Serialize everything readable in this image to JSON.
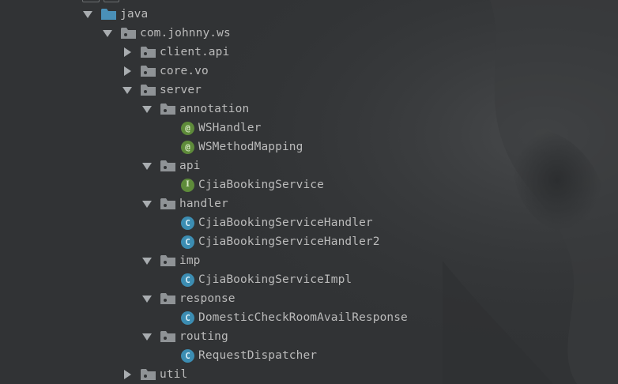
{
  "tree": {
    "src_java": {
      "label": "java",
      "expanded": true,
      "icon": "source-folder-icon"
    },
    "package_root": {
      "label": "com.johnny.ws",
      "expanded": true,
      "icon": "package-icon"
    },
    "client_api": {
      "label": "client.api",
      "expanded": false,
      "icon": "package-icon"
    },
    "core_vo": {
      "label": "core.vo",
      "expanded": false,
      "icon": "package-icon"
    },
    "server": {
      "label": "server",
      "expanded": true,
      "icon": "package-icon"
    },
    "annotation": {
      "label": "annotation",
      "expanded": true,
      "icon": "package-icon"
    },
    "ws_handler": {
      "label": "WSHandler",
      "kind": "annotation",
      "badge": "@"
    },
    "ws_method_mapping": {
      "label": "WSMethodMapping",
      "kind": "annotation",
      "badge": "@"
    },
    "api": {
      "label": "api",
      "expanded": true,
      "icon": "package-icon"
    },
    "cjia_booking_service": {
      "label": "CjiaBookingService",
      "kind": "interface",
      "badge": "I"
    },
    "handler": {
      "label": "handler",
      "expanded": true,
      "icon": "package-icon"
    },
    "cjia_booking_service_handler": {
      "label": "CjiaBookingServiceHandler",
      "kind": "class",
      "badge": "C"
    },
    "cjia_booking_service_handler2": {
      "label": "CjiaBookingServiceHandler2",
      "kind": "class",
      "badge": "C"
    },
    "imp": {
      "label": "imp",
      "expanded": true,
      "icon": "package-icon"
    },
    "cjia_booking_service_impl": {
      "label": "CjiaBookingServiceImpl",
      "kind": "class",
      "badge": "C"
    },
    "response": {
      "label": "response",
      "expanded": true,
      "icon": "package-icon"
    },
    "domestic_check_room_avail_response": {
      "label": "DomesticCheckRoomAvailResponse",
      "kind": "class",
      "badge": "C"
    },
    "routing": {
      "label": "routing",
      "expanded": true,
      "icon": "package-icon"
    },
    "request_dispatcher": {
      "label": "RequestDispatcher",
      "kind": "class",
      "badge": "C"
    },
    "util": {
      "label": "util",
      "expanded": false,
      "icon": "package-icon"
    }
  },
  "colors": {
    "background": "#313335",
    "text": "#bbbbbb",
    "folder": "#8f9396",
    "source_folder": "#4a90b8",
    "arrow": "#a9adb0",
    "annotation_badge": "#5e8b3a",
    "interface_badge": "#5e8b3a",
    "class_badge": "#3c8db2"
  }
}
